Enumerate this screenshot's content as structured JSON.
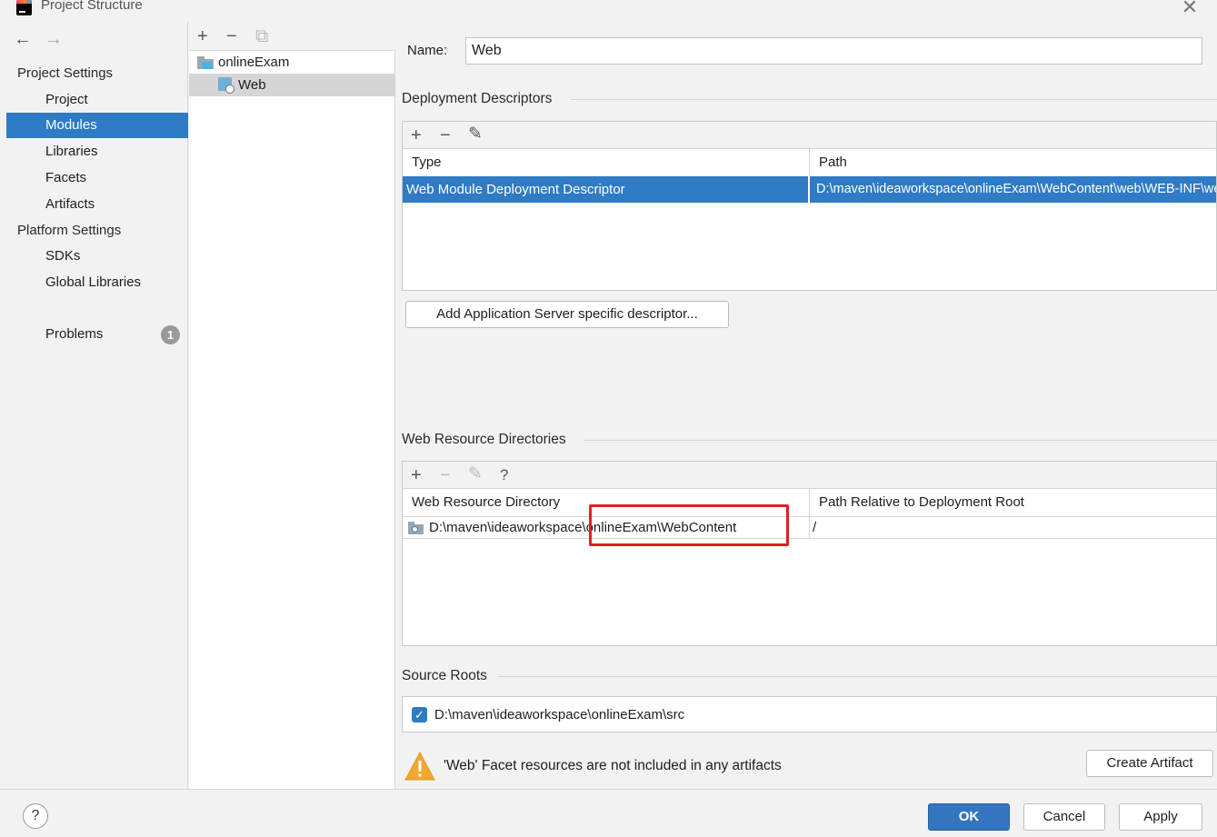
{
  "window": {
    "title": "Project Structure",
    "close_glyph": "✕"
  },
  "nav": {
    "back_glyph": "←",
    "forward_glyph": "→",
    "project_settings_header": "Project Settings",
    "project_items": [
      "Project",
      "Modules",
      "Libraries",
      "Facets",
      "Artifacts"
    ],
    "platform_settings_header": "Platform Settings",
    "platform_items": [
      "SDKs",
      "Global Libraries"
    ],
    "problems_label": "Problems",
    "problems_count": "1",
    "selected": "Modules"
  },
  "tree": {
    "toolbar": {
      "add": "+",
      "remove": "−",
      "copy": "⧉"
    },
    "items": [
      {
        "label": "onlineExam",
        "icon": "module-folder-icon"
      },
      {
        "label": "Web",
        "icon": "web-facet-icon",
        "selected": true
      }
    ]
  },
  "main": {
    "name_label": "Name:",
    "name_value": "Web",
    "deployment": {
      "title": "Deployment Descriptors",
      "toolbar": {
        "add": "+",
        "remove": "−",
        "edit": "✎"
      },
      "columns": [
        "Type",
        "Path"
      ],
      "rows": [
        {
          "type": "Web Module Deployment Descriptor",
          "path": "D:\\maven\\ideaworkspace\\onlineExam\\WebContent\\web\\WEB-INF\\web.xml"
        }
      ],
      "add_server_button": "Add Application Server specific descriptor..."
    },
    "web_resources": {
      "title": "Web Resource Directories",
      "toolbar": {
        "add": "+",
        "remove": "−",
        "edit": "✎",
        "help": "?"
      },
      "columns": [
        "Web Resource Directory",
        "Path Relative to Deployment Root"
      ],
      "rows": [
        {
          "directory": "D:\\maven\\ideaworkspace\\onlineExam\\WebContent",
          "relative": "/"
        }
      ]
    },
    "source_roots": {
      "title": "Source Roots",
      "items": [
        {
          "path": "D:\\maven\\ideaworkspace\\onlineExam\\src",
          "checked": true
        }
      ]
    },
    "warning": {
      "text": "'Web' Facet resources are not included in any artifacts",
      "button": "Create Artifact"
    }
  },
  "footer": {
    "help": "?",
    "ok": "OK",
    "cancel": "Cancel",
    "apply": "Apply"
  },
  "colors": {
    "selection": "#2f7bc6",
    "annotation": "#e02020",
    "warning": "#f0a830"
  }
}
